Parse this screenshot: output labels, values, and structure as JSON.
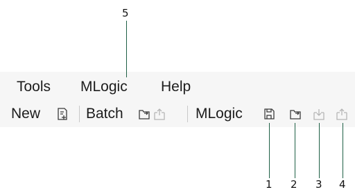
{
  "menubar": {
    "items": [
      {
        "label": "Tools"
      },
      {
        "label": "MLogic"
      },
      {
        "label": "Help"
      }
    ]
  },
  "toolbar": {
    "new_label": "New",
    "batch_label": "Batch",
    "mlogic_label": "MLogic",
    "icons": {
      "new_file": "new-file-icon",
      "batch_open": "folder-open-icon",
      "batch_export": "export-disabled-icon",
      "mlogic_save": "save-icon",
      "mlogic_open": "folder-open-icon",
      "mlogic_import": "import-disabled-icon",
      "mlogic_export": "export-disabled-icon"
    }
  },
  "callouts": {
    "c1": "1",
    "c2": "2",
    "c3": "3",
    "c4": "4",
    "c5": "5"
  },
  "colors": {
    "leader": "#1d5f44",
    "icon_active": "#3a3a3a",
    "icon_disabled": "#b5b5b5",
    "bar_bg": "#f6f6f6"
  }
}
